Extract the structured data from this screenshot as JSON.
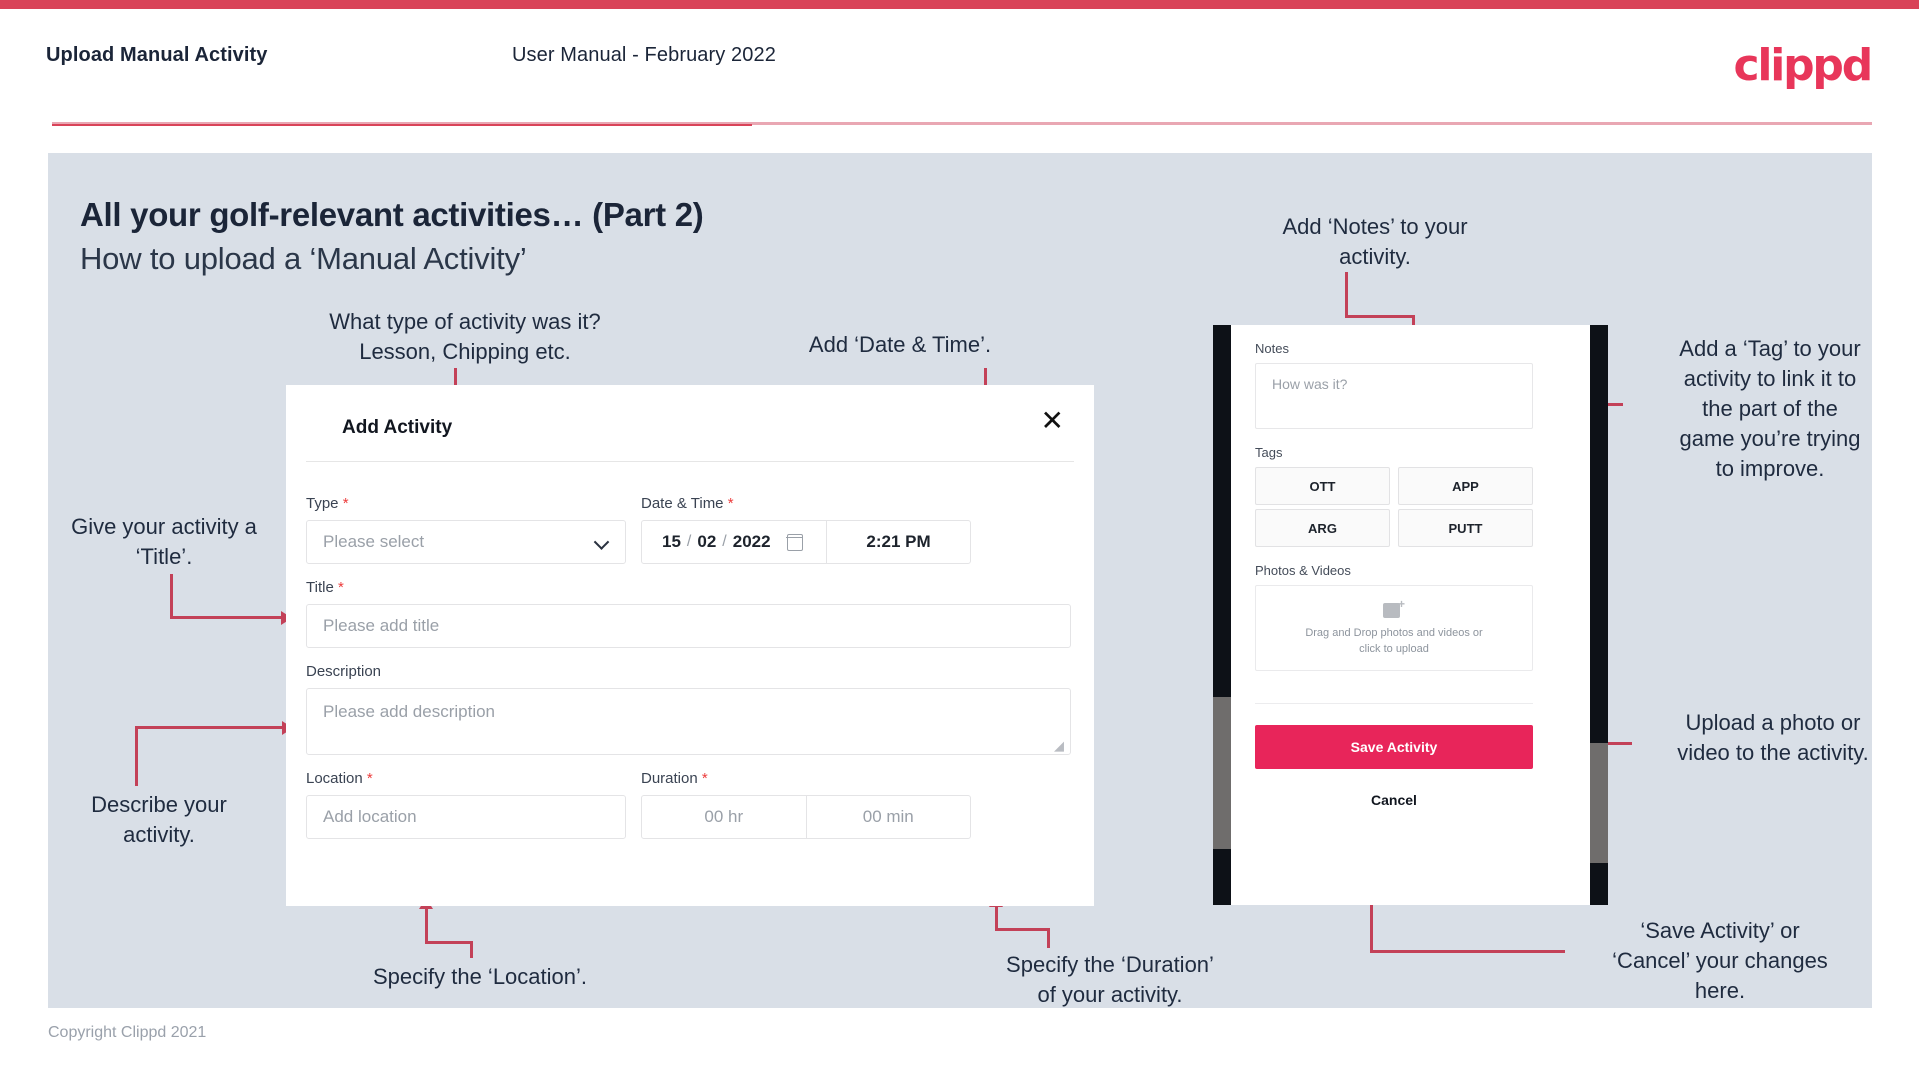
{
  "header": {
    "title": "Upload Manual Activity",
    "subtitle": "User Manual - February 2022",
    "logo": "clippd"
  },
  "slide": {
    "heading": "All your golf-relevant activities… (Part 2)",
    "subheading": "How to upload a ‘Manual Activity’"
  },
  "dialog": {
    "title": "Add Activity",
    "close_icon": "✕",
    "type": {
      "label": "Type",
      "required": "*",
      "placeholder": "Please select"
    },
    "datetime": {
      "label": "Date & Time",
      "required": "*",
      "day": "15",
      "month": "02",
      "year": "2022",
      "sep1": "/",
      "sep2": "/",
      "time": "2:21 PM"
    },
    "title_field": {
      "label": "Title",
      "required": "*",
      "placeholder": "Please add title"
    },
    "description": {
      "label": "Description",
      "placeholder": "Please add description"
    },
    "location": {
      "label": "Location",
      "required": "*",
      "placeholder": "Add location"
    },
    "duration": {
      "label": "Duration",
      "required": "*",
      "hours": "00 hr",
      "minutes": "00 min"
    }
  },
  "phone": {
    "notes": {
      "label": "Notes",
      "placeholder": "How was it?"
    },
    "tags": {
      "label": "Tags",
      "items": [
        "OTT",
        "APP",
        "ARG",
        "PUTT"
      ]
    },
    "photos": {
      "label": "Photos & Videos",
      "drop_line1": "Drag and Drop photos and videos or",
      "drop_line2": "click to upload"
    },
    "save_label": "Save Activity",
    "cancel_label": "Cancel"
  },
  "annotations": {
    "type": "What type of activity was it?\nLesson, Chipping etc.",
    "datetime": "Add ‘Date & Time’.",
    "title": "Give your activity a\n‘Title’.",
    "description": "Describe your\nactivity.",
    "location": "Specify the ‘Location’.",
    "duration": "Specify the ‘Duration’\nof your activity.",
    "notes": "Add ‘Notes’ to your\nactivity.",
    "tags": "Add a ‘Tag’ to your\nactivity to link it to\nthe part of the\ngame you’re trying\nto improve.",
    "upload": "Upload a photo or\nvideo to the activity.",
    "save": "‘Save Activity’ or\n‘Cancel’ your changes\nhere."
  },
  "footer": {
    "copyright": "Copyright Clippd 2021"
  },
  "colors": {
    "accent": "#e8255a",
    "brand_rule": "#d94459",
    "arrow": "#c34158",
    "panel_bg": "#d9dfe7",
    "text": "#1b2538"
  }
}
